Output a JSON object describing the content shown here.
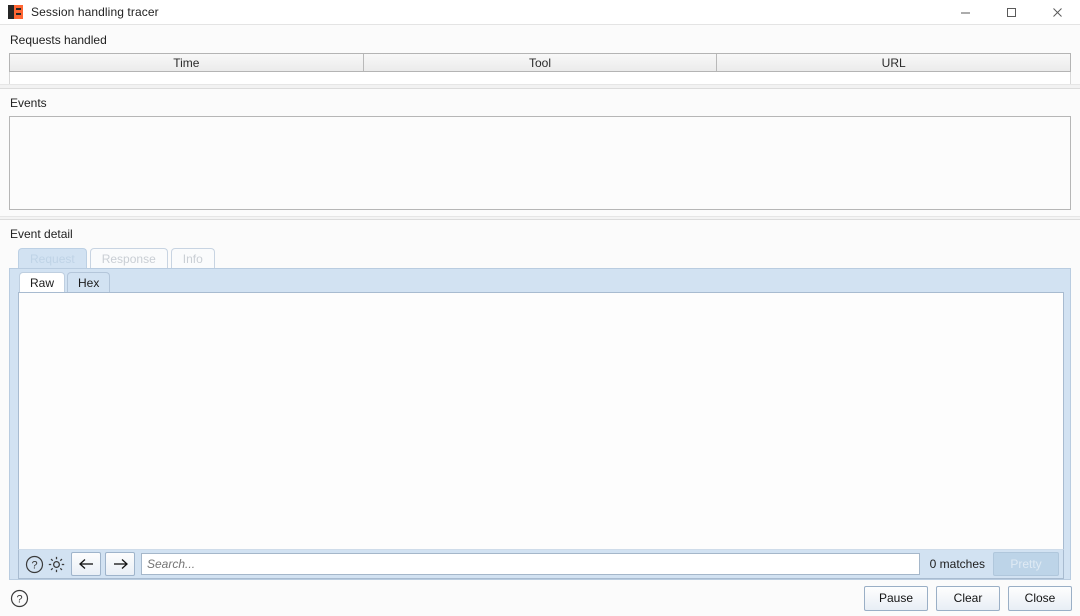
{
  "window": {
    "title": "Session handling tracer",
    "app_icon": "burp-suite-logo-icon",
    "controls": {
      "minimize": "minimize-icon",
      "maximize": "maximize-icon",
      "close": "close-icon"
    }
  },
  "requests_handled": {
    "label": "Requests handled",
    "columns": [
      "Time",
      "Tool",
      "URL"
    ],
    "rows": []
  },
  "events": {
    "label": "Events",
    "rows": []
  },
  "event_detail": {
    "label": "Event detail",
    "tabs": [
      {
        "label": "Request",
        "selected": true,
        "disabled": true
      },
      {
        "label": "Response",
        "selected": false,
        "disabled": true
      },
      {
        "label": "Info",
        "selected": false,
        "disabled": true
      }
    ],
    "view_tabs": [
      {
        "label": "Raw",
        "selected": true
      },
      {
        "label": "Hex",
        "selected": false
      }
    ],
    "content": "",
    "search": {
      "help_icon": "question-mark-icon",
      "settings_icon": "gear-icon",
      "prev_icon": "arrow-left-icon",
      "next_icon": "arrow-right-icon",
      "placeholder": "Search...",
      "value": "",
      "matches": "0 matches",
      "pretty_label": "Pretty"
    }
  },
  "footer": {
    "help_icon": "question-mark-icon",
    "buttons": [
      "Pause",
      "Clear",
      "Close"
    ]
  },
  "colors": {
    "panel_blue": "#d2e2f2",
    "accent_orange": "#ff6633",
    "border_gray": "#b4b4b4"
  }
}
